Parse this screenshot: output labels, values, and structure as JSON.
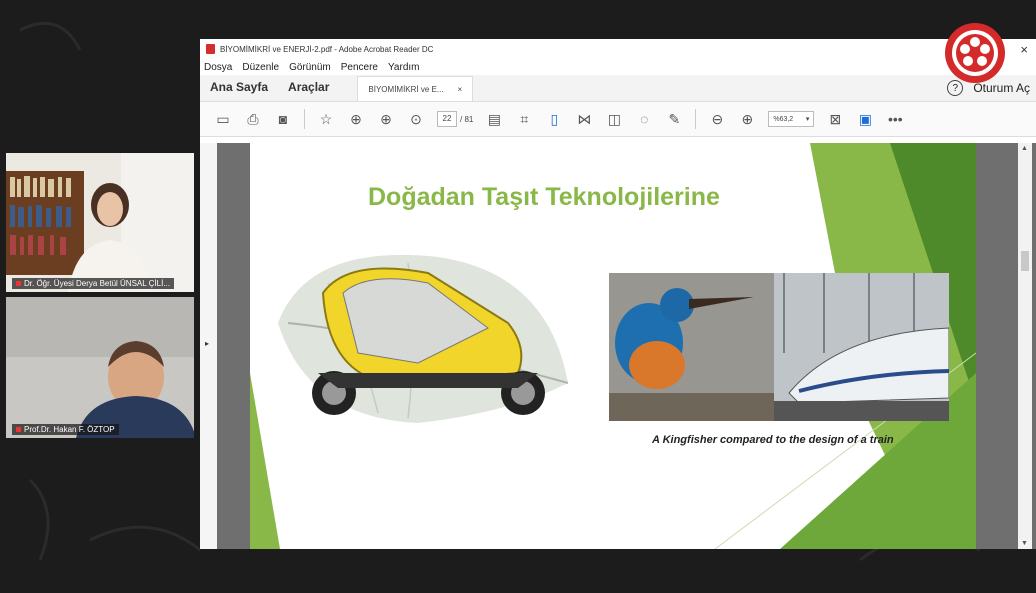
{
  "participants": [
    {
      "name": "Dr. Öğr. Üyesi Derya Betül ÜNSAL ÇİLİ..."
    },
    {
      "name": "Prof.Dr. Hakan F. ÖZTOP"
    }
  ],
  "window": {
    "title": "BİYOMİMİKRİ ve ENERJİ-2.pdf - Adobe Acrobat Reader DC",
    "menu": [
      "Dosya",
      "Düzenle",
      "Görünüm",
      "Pencere",
      "Yardım"
    ],
    "nav_tabs": [
      "Ana Sayfa",
      "Araçlar"
    ],
    "doc_tab": "BİYOMİMİKRİ ve E...",
    "doc_tab_close": "×",
    "help": "?",
    "signin": "Oturum Aç",
    "close": "×"
  },
  "toolbar": {
    "page_current": "22",
    "page_total": "/ 81",
    "zoom": "%63,2",
    "zoom_arrow": "▾",
    "more": "•••"
  },
  "slide": {
    "title": "Doğadan Taşıt Teknolojilerine",
    "caption": "A Kingfisher compared to the design of a train",
    "colors": {
      "accent_green": "#8ab848",
      "dark_green": "#4e8a2a"
    }
  },
  "gutter": {
    "left_arrow": "▸",
    "up": "▲",
    "down": "▼"
  }
}
